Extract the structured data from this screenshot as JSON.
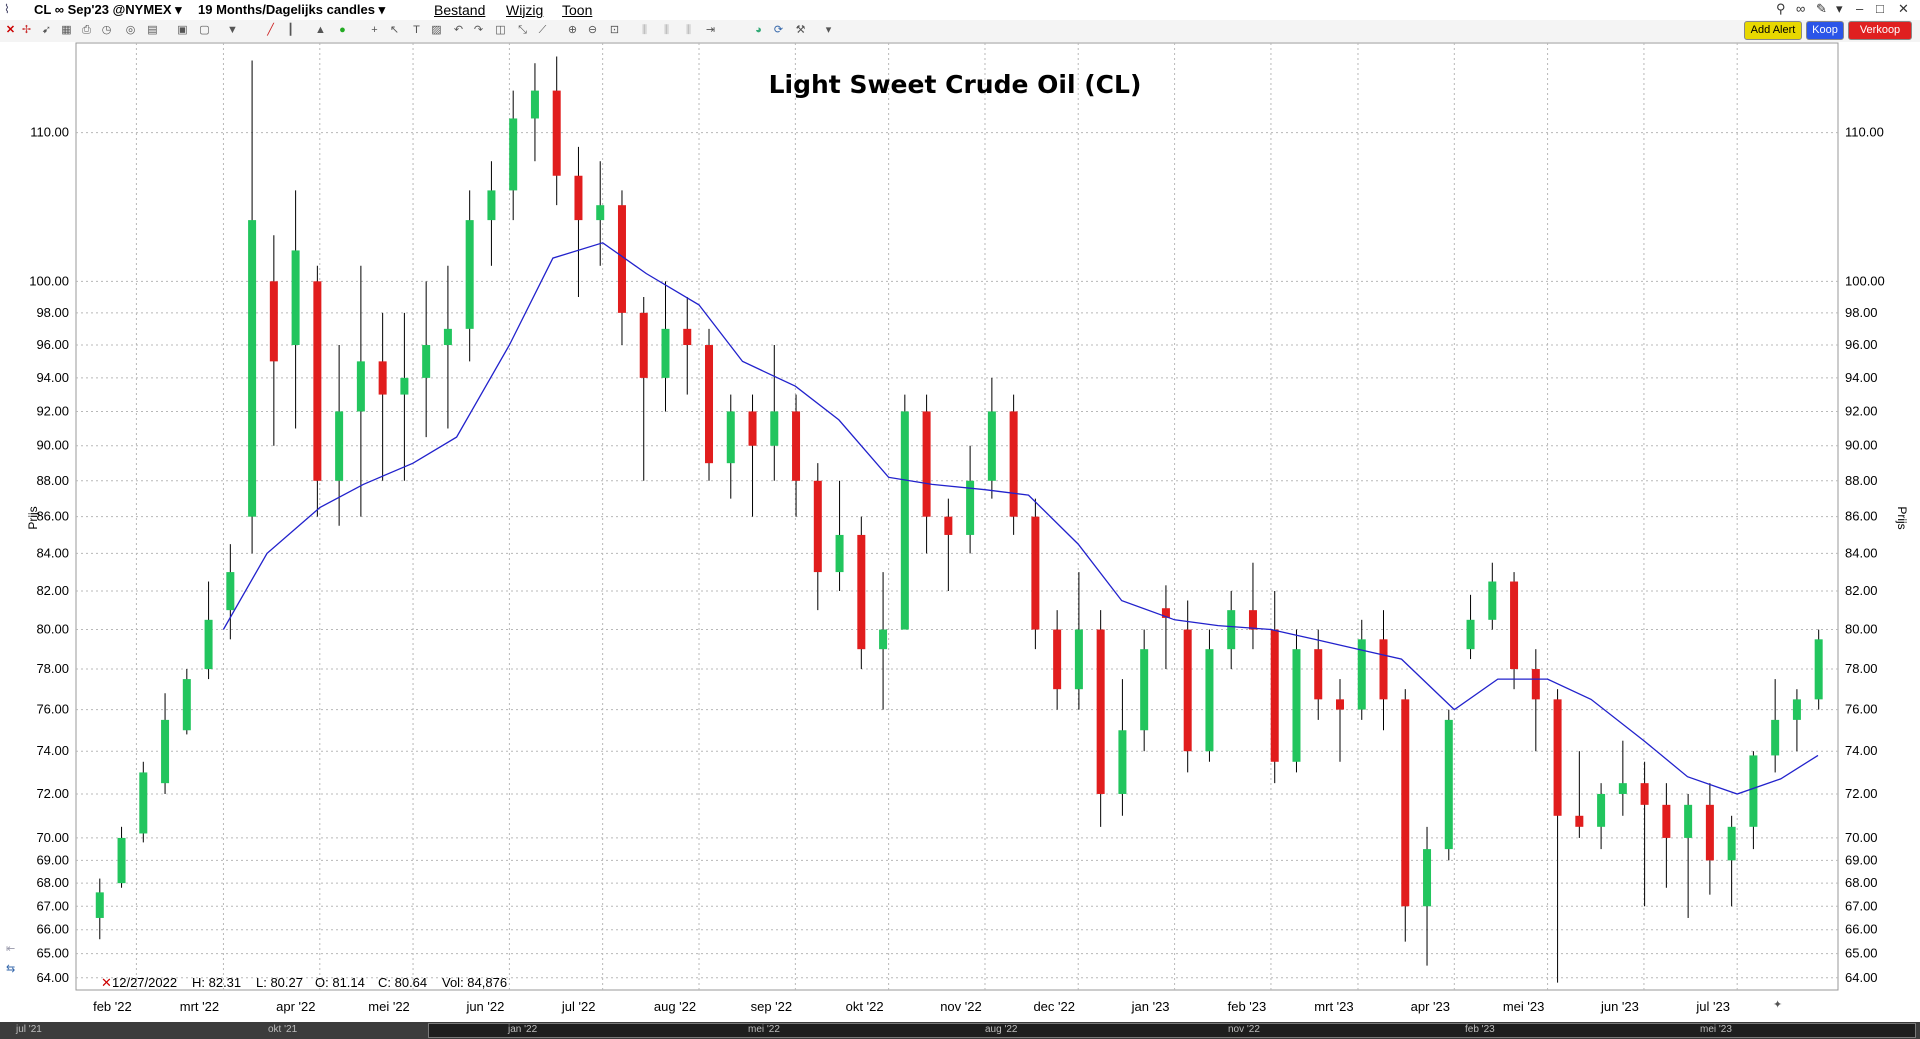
{
  "title_bar": {
    "symbol_menu": "CL ∞ Sep'23 @NYMEX",
    "period_menu": "19 Months/Dagelijks candles",
    "menu_items": [
      "Bestand",
      "Wijzig",
      "Toon"
    ]
  },
  "buttons": {
    "add_alert": "Add Alert",
    "buy": "Koop",
    "sell": "Verkoop"
  },
  "colors": {
    "up_candle": "#22c55e",
    "down_candle": "#e11d1d",
    "moving_average": "#2222cc",
    "add_alert_bg": "#e8d800",
    "buy_bg": "#2b55e8",
    "sell_bg": "#e02020"
  },
  "info_readout": {
    "date": "12/27/2022",
    "high": "H: 82.31",
    "low": "L: 80.27",
    "open": "O: 81.14",
    "close": "C: 80.64",
    "volume": "Vol: 84,876"
  },
  "scrollbar": {
    "labels": [
      "jul '21",
      "okt '21",
      "jan '22",
      "mei '22",
      "aug '22",
      "nov '22",
      "feb '23",
      "mei '23"
    ]
  },
  "chart_data": {
    "type": "candlestick",
    "title": "Light Sweet Crude Oil (CL)",
    "ylabel_left": "Prijs",
    "ylabel_right": "Prijs",
    "y_scale": "log",
    "ylim": [
      63.5,
      116.5
    ],
    "grid": true,
    "y_ticks": [
      "64.00",
      "65.00",
      "66.00",
      "67.00",
      "68.00",
      "69.00",
      "70.00",
      "72.00",
      "74.00",
      "76.00",
      "78.00",
      "80.00",
      "82.00",
      "84.00",
      "86.00",
      "88.00",
      "90.00",
      "92.00",
      "94.00",
      "96.00",
      "98.00",
      "100.00",
      "110.00"
    ],
    "x_ticks": [
      "feb '22",
      "mrt '22",
      "apr '22",
      "mei '22",
      "jun '22",
      "jul '22",
      "aug '22",
      "sep '22",
      "okt '22",
      "nov '22",
      "dec '22",
      "jan '23",
      "feb '23",
      "mrt '23",
      "apr '23",
      "mei '23",
      "jun '23",
      "jul '23"
    ],
    "x_range": [
      "2022-01-19",
      "2023-07-27"
    ],
    "weekly_candles": [
      {
        "week_start": "2022-01-17",
        "open": 66.5,
        "high": 68.2,
        "low": 65.6,
        "close": 67.6
      },
      {
        "week_start": "2022-01-24",
        "open": 68.0,
        "high": 70.5,
        "low": 67.8,
        "close": 70.0
      },
      {
        "week_start": "2022-01-31",
        "open": 70.2,
        "high": 73.5,
        "low": 69.8,
        "close": 73.0
      },
      {
        "week_start": "2022-02-07",
        "open": 72.5,
        "high": 76.8,
        "low": 72.0,
        "close": 75.5
      },
      {
        "week_start": "2022-02-14",
        "open": 75.0,
        "high": 78.0,
        "low": 74.8,
        "close": 77.5
      },
      {
        "week_start": "2022-02-21",
        "open": 78.0,
        "high": 82.5,
        "low": 77.5,
        "close": 80.5
      },
      {
        "week_start": "2022-02-28",
        "open": 81.0,
        "high": 84.5,
        "low": 79.5,
        "close": 83.0
      },
      {
        "week_start": "2022-03-07",
        "open": 86.0,
        "high": 115.2,
        "low": 84.0,
        "close": 104.0
      },
      {
        "week_start": "2022-03-14",
        "open": 100.0,
        "high": 103.0,
        "low": 90.0,
        "close": 95.0
      },
      {
        "week_start": "2022-03-21",
        "open": 96.0,
        "high": 106.0,
        "low": 91.0,
        "close": 102.0
      },
      {
        "week_start": "2022-03-28",
        "open": 100.0,
        "high": 101.0,
        "low": 86.0,
        "close": 88.0
      },
      {
        "week_start": "2022-04-04",
        "open": 88.0,
        "high": 96.0,
        "low": 85.5,
        "close": 92.0
      },
      {
        "week_start": "2022-04-11",
        "open": 92.0,
        "high": 101.0,
        "low": 86.0,
        "close": 95.0
      },
      {
        "week_start": "2022-04-18",
        "open": 95.0,
        "high": 98.0,
        "low": 88.0,
        "close": 93.0
      },
      {
        "week_start": "2022-04-25",
        "open": 93.0,
        "high": 98.0,
        "low": 88.0,
        "close": 94.0
      },
      {
        "week_start": "2022-05-02",
        "open": 94.0,
        "high": 100.0,
        "low": 90.5,
        "close": 96.0
      },
      {
        "week_start": "2022-05-09",
        "open": 96.0,
        "high": 101.0,
        "low": 91.0,
        "close": 97.0
      },
      {
        "week_start": "2022-05-16",
        "open": 97.0,
        "high": 106.0,
        "low": 95.0,
        "close": 104.0
      },
      {
        "week_start": "2022-05-23",
        "open": 104.0,
        "high": 108.0,
        "low": 101.0,
        "close": 106.0
      },
      {
        "week_start": "2022-05-30",
        "open": 106.0,
        "high": 113.0,
        "low": 104.0,
        "close": 111.0
      },
      {
        "week_start": "2022-06-06",
        "open": 111.0,
        "high": 115.0,
        "low": 108.0,
        "close": 113.0
      },
      {
        "week_start": "2022-06-13",
        "open": 113.0,
        "high": 115.5,
        "low": 105.0,
        "close": 107.0
      },
      {
        "week_start": "2022-06-20",
        "open": 107.0,
        "high": 109.0,
        "low": 99.0,
        "close": 104.0
      },
      {
        "week_start": "2022-06-27",
        "open": 104.0,
        "high": 108.0,
        "low": 101.0,
        "close": 105.0
      },
      {
        "week_start": "2022-07-04",
        "open": 105.0,
        "high": 106.0,
        "low": 96.0,
        "close": 98.0
      },
      {
        "week_start": "2022-07-11",
        "open": 98.0,
        "high": 99.0,
        "low": 88.0,
        "close": 94.0
      },
      {
        "week_start": "2022-07-18",
        "open": 94.0,
        "high": 100.0,
        "low": 92.0,
        "close": 97.0
      },
      {
        "week_start": "2022-07-25",
        "open": 97.0,
        "high": 99.0,
        "low": 93.0,
        "close": 96.0
      },
      {
        "week_start": "2022-08-01",
        "open": 96.0,
        "high": 97.0,
        "low": 88.0,
        "close": 89.0
      },
      {
        "week_start": "2022-08-08",
        "open": 89.0,
        "high": 93.0,
        "low": 87.0,
        "close": 92.0
      },
      {
        "week_start": "2022-08-15",
        "open": 92.0,
        "high": 93.0,
        "low": 86.0,
        "close": 90.0
      },
      {
        "week_start": "2022-08-22",
        "open": 90.0,
        "high": 96.0,
        "low": 88.0,
        "close": 92.0
      },
      {
        "week_start": "2022-08-29",
        "open": 92.0,
        "high": 93.0,
        "low": 86.0,
        "close": 88.0
      },
      {
        "week_start": "2022-09-05",
        "open": 88.0,
        "high": 89.0,
        "low": 81.0,
        "close": 83.0
      },
      {
        "week_start": "2022-09-12",
        "open": 83.0,
        "high": 88.0,
        "low": 82.0,
        "close": 85.0
      },
      {
        "week_start": "2022-09-19",
        "open": 85.0,
        "high": 86.0,
        "low": 78.0,
        "close": 79.0
      },
      {
        "week_start": "2022-09-26",
        "open": 79.0,
        "high": 83.0,
        "low": 76.0,
        "close": 80.0
      },
      {
        "week_start": "2022-10-03",
        "open": 80.0,
        "high": 93.0,
        "low": 80.0,
        "close": 92.0
      },
      {
        "week_start": "2022-10-10",
        "open": 92.0,
        "high": 93.0,
        "low": 84.0,
        "close": 86.0
      },
      {
        "week_start": "2022-10-17",
        "open": 86.0,
        "high": 87.0,
        "low": 82.0,
        "close": 85.0
      },
      {
        "week_start": "2022-10-24",
        "open": 85.0,
        "high": 90.0,
        "low": 84.0,
        "close": 88.0
      },
      {
        "week_start": "2022-10-31",
        "open": 88.0,
        "high": 94.0,
        "low": 87.0,
        "close": 92.0
      },
      {
        "week_start": "2022-11-07",
        "open": 92.0,
        "high": 93.0,
        "low": 85.0,
        "close": 86.0
      },
      {
        "week_start": "2022-11-14",
        "open": 86.0,
        "high": 87.0,
        "low": 79.0,
        "close": 80.0
      },
      {
        "week_start": "2022-11-21",
        "open": 80.0,
        "high": 81.0,
        "low": 76.0,
        "close": 77.0
      },
      {
        "week_start": "2022-11-28",
        "open": 77.0,
        "high": 83.0,
        "low": 76.0,
        "close": 80.0
      },
      {
        "week_start": "2022-12-05",
        "open": 80.0,
        "high": 81.0,
        "low": 70.5,
        "close": 72.0
      },
      {
        "week_start": "2022-12-12",
        "open": 72.0,
        "high": 77.5,
        "low": 71.0,
        "close": 75.0
      },
      {
        "week_start": "2022-12-19",
        "open": 75.0,
        "high": 80.0,
        "low": 74.0,
        "close": 79.0
      },
      {
        "week_start": "2022-12-26",
        "open": 81.1,
        "high": 82.3,
        "low": 78.0,
        "close": 80.6
      },
      {
        "week_start": "2023-01-02",
        "open": 80.0,
        "high": 81.5,
        "low": 73.0,
        "close": 74.0
      },
      {
        "week_start": "2023-01-09",
        "open": 74.0,
        "high": 80.0,
        "low": 73.5,
        "close": 79.0
      },
      {
        "week_start": "2023-01-16",
        "open": 79.0,
        "high": 82.0,
        "low": 78.0,
        "close": 81.0
      },
      {
        "week_start": "2023-01-23",
        "open": 81.0,
        "high": 83.5,
        "low": 79.0,
        "close": 80.0
      },
      {
        "week_start": "2023-01-30",
        "open": 80.0,
        "high": 82.0,
        "low": 72.5,
        "close": 73.5
      },
      {
        "week_start": "2023-02-06",
        "open": 73.5,
        "high": 80.0,
        "low": 73.0,
        "close": 79.0
      },
      {
        "week_start": "2023-02-13",
        "open": 79.0,
        "high": 80.0,
        "low": 75.5,
        "close": 76.5
      },
      {
        "week_start": "2023-02-20",
        "open": 76.5,
        "high": 77.5,
        "low": 73.5,
        "close": 76.0
      },
      {
        "week_start": "2023-02-27",
        "open": 76.0,
        "high": 80.5,
        "low": 75.5,
        "close": 79.5
      },
      {
        "week_start": "2023-03-06",
        "open": 79.5,
        "high": 81.0,
        "low": 75.0,
        "close": 76.5
      },
      {
        "week_start": "2023-03-13",
        "open": 76.5,
        "high": 77.0,
        "low": 65.5,
        "close": 67.0
      },
      {
        "week_start": "2023-03-20",
        "open": 67.0,
        "high": 70.5,
        "low": 64.5,
        "close": 69.5
      },
      {
        "week_start": "2023-03-27",
        "open": 69.5,
        "high": 76.0,
        "low": 69.0,
        "close": 75.5
      },
      {
        "week_start": "2023-04-03",
        "open": 79.0,
        "high": 81.8,
        "low": 78.5,
        "close": 80.5
      },
      {
        "week_start": "2023-04-10",
        "open": 80.5,
        "high": 83.5,
        "low": 80.0,
        "close": 82.5
      },
      {
        "week_start": "2023-04-17",
        "open": 82.5,
        "high": 83.0,
        "low": 77.0,
        "close": 78.0
      },
      {
        "week_start": "2023-04-24",
        "open": 78.0,
        "high": 79.0,
        "low": 74.0,
        "close": 76.5
      },
      {
        "week_start": "2023-05-01",
        "open": 76.5,
        "high": 77.0,
        "low": 63.8,
        "close": 71.0
      },
      {
        "week_start": "2023-05-08",
        "open": 71.0,
        "high": 74.0,
        "low": 70.0,
        "close": 70.5
      },
      {
        "week_start": "2023-05-15",
        "open": 70.5,
        "high": 72.5,
        "low": 69.5,
        "close": 72.0
      },
      {
        "week_start": "2023-05-22",
        "open": 72.0,
        "high": 74.5,
        "low": 71.0,
        "close": 72.5
      },
      {
        "week_start": "2023-05-29",
        "open": 72.5,
        "high": 73.5,
        "low": 67.0,
        "close": 71.5
      },
      {
        "week_start": "2023-06-05",
        "open": 71.5,
        "high": 72.5,
        "low": 67.8,
        "close": 70.0
      },
      {
        "week_start": "2023-06-12",
        "open": 70.0,
        "high": 72.0,
        "low": 66.5,
        "close": 71.5
      },
      {
        "week_start": "2023-06-19",
        "open": 71.5,
        "high": 72.5,
        "low": 67.5,
        "close": 69.0
      },
      {
        "week_start": "2023-06-26",
        "open": 69.0,
        "high": 71.0,
        "low": 67.0,
        "close": 70.5
      },
      {
        "week_start": "2023-07-03",
        "open": 70.5,
        "high": 74.0,
        "low": 69.5,
        "close": 73.8
      },
      {
        "week_start": "2023-07-10",
        "open": 73.8,
        "high": 77.5,
        "low": 73.0,
        "close": 75.5
      },
      {
        "week_start": "2023-07-17",
        "open": 75.5,
        "high": 77.0,
        "low": 74.0,
        "close": 76.5
      },
      {
        "week_start": "2023-07-24",
        "open": 76.5,
        "high": 80.0,
        "low": 76.0,
        "close": 79.5
      }
    ],
    "moving_average": {
      "x": [
        "2022-03-01",
        "2022-03-15",
        "2022-04-01",
        "2022-04-15",
        "2022-05-01",
        "2022-05-15",
        "2022-06-01",
        "2022-06-15",
        "2022-07-01",
        "2022-07-15",
        "2022-08-01",
        "2022-08-15",
        "2022-09-01",
        "2022-09-15",
        "2022-10-01",
        "2022-10-15",
        "2022-11-01",
        "2022-11-15",
        "2022-12-01",
        "2022-12-15",
        "2023-01-01",
        "2023-01-15",
        "2023-02-01",
        "2023-02-15",
        "2023-03-01",
        "2023-03-15",
        "2023-04-01",
        "2023-04-15",
        "2023-05-01",
        "2023-05-15",
        "2023-06-01",
        "2023-06-15",
        "2023-07-01",
        "2023-07-15",
        "2023-07-27"
      ],
      "y": [
        80.0,
        84.0,
        86.5,
        87.8,
        89.0,
        90.5,
        96.0,
        101.5,
        102.5,
        100.5,
        98.5,
        95.0,
        93.5,
        91.5,
        88.2,
        87.8,
        87.5,
        87.2,
        84.5,
        81.5,
        80.5,
        80.2,
        80.0,
        79.5,
        79.0,
        78.5,
        76.0,
        77.5,
        77.5,
        76.5,
        74.5,
        72.8,
        72.0,
        72.7,
        73.8
      ]
    }
  }
}
